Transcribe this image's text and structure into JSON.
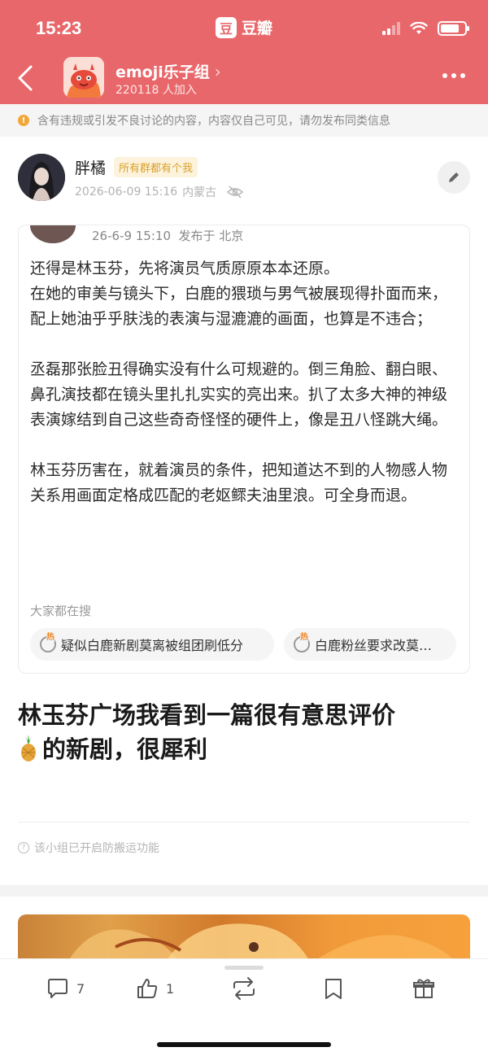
{
  "status_bar": {
    "time": "15:23",
    "app_name": "豆瓣",
    "app_logo": "豆"
  },
  "header": {
    "group_name": "emoji乐子组",
    "member_count": "220118 人加入",
    "chevron": "›"
  },
  "notice": {
    "text": "含有违规或引发不良讨论的内容，内容仅自己可见，请勿发布同类信息"
  },
  "author": {
    "name": "胖橘",
    "badge": "所有群都有个我",
    "datetime": "2026-06-09 15:16",
    "location": "内蒙古"
  },
  "quoted_post": {
    "meta": "26-6-9 15:10  发布于 北京",
    "paragraphs": [
      "还得是林玉芬，先将演员气质原原本本还原。\n在她的审美与镜头下，白鹿的猥琐与男气被展现得扑面而来，配上她油乎乎肤浅的表演与湿漉漉的画面，也算是不违合；",
      "丞磊那张脸丑得确实没有什么可规避的。倒三角脸、翻白眼、鼻孔演技都在镜头里扎扎实实的亮出来。扒了太多大神的神级表演嫁结到自己这些奇奇怪怪的硬件上，像是丑八怪跳大绳。",
      "林玉芬历害在，就着演员的条件，把知道达不到的人物感人物关系用画面定格成匹配的老妪鳏夫油里浪。可全身而退。"
    ],
    "search_label": "大家都在搜",
    "hot_tag": "热",
    "chips": [
      "疑似白鹿新剧莫离被组团刷低分",
      "白鹿粉丝要求改莫…"
    ]
  },
  "post": {
    "title_line1": "林玉芬广场我看到一篇很有意思评价",
    "title_line2": "的新剧，很犀利",
    "anti_copy": "该小组已开启防搬运功能"
  },
  "actions": {
    "comments": "7",
    "likes": "1"
  },
  "colors": {
    "brand": "#e8676b",
    "badge_text": "#d9a12b",
    "hot": "#f08a2a"
  }
}
